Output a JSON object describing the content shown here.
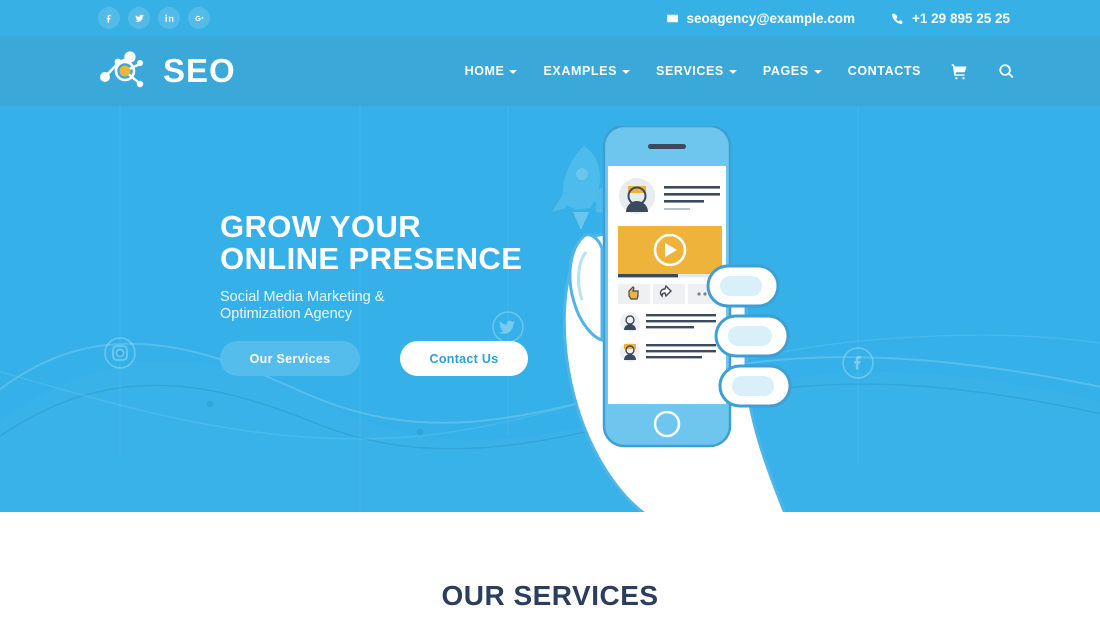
{
  "topbar": {
    "socials": [
      {
        "name": "facebook-icon",
        "label": "Facebook"
      },
      {
        "name": "twitter-icon",
        "label": "Twitter"
      },
      {
        "name": "linkedin-icon",
        "label": "LinkedIn"
      },
      {
        "name": "googleplus-icon",
        "label": "Google Plus"
      }
    ],
    "email": "seoagency@example.com",
    "phone": "+1 29 895 25 25",
    "email_icon": "envelope-icon",
    "phone_icon": "phone-icon"
  },
  "header": {
    "logo_text": "SEO",
    "logo_icon": "network-nodes-icon",
    "nav": [
      {
        "label": "HOME",
        "has_dropdown": true
      },
      {
        "label": "EXAMPLES",
        "has_dropdown": true
      },
      {
        "label": "SERVICES",
        "has_dropdown": true
      },
      {
        "label": "PAGES",
        "has_dropdown": true
      },
      {
        "label": "CONTACTS",
        "has_dropdown": false
      }
    ],
    "cart_icon": "shopping-cart-icon",
    "search_icon": "search-icon"
  },
  "hero": {
    "title_line1": "GROW YOUR",
    "title_line2": "ONLINE PRESENCE",
    "subtitle_line1": "Social Media Marketing &",
    "subtitle_line2": "Optimization Agency",
    "primary_button": "Our Services",
    "secondary_button": "Contact Us",
    "decor_markers": [
      {
        "name": "instagram-marker-icon"
      },
      {
        "name": "twitter-marker-icon"
      },
      {
        "name": "youtube-marker-icon"
      },
      {
        "name": "facebook-marker-icon"
      }
    ],
    "illustration": {
      "name": "hand-holding-phone-illustration",
      "rocket": "rocket-icon",
      "post_actions": [
        "like-icon",
        "share-icon",
        "more-icon"
      ],
      "video_play": "play-button-icon"
    }
  },
  "services": {
    "title": "OUR SERVICES"
  },
  "colors": {
    "topbar_blue": "#37b0e5",
    "nav_blue": "#3aa9da",
    "hero_blue": "#35b0e8",
    "accent_yellow": "#eeb33b",
    "heading_navy": "#2c3e5d",
    "white": "#ffffff"
  }
}
